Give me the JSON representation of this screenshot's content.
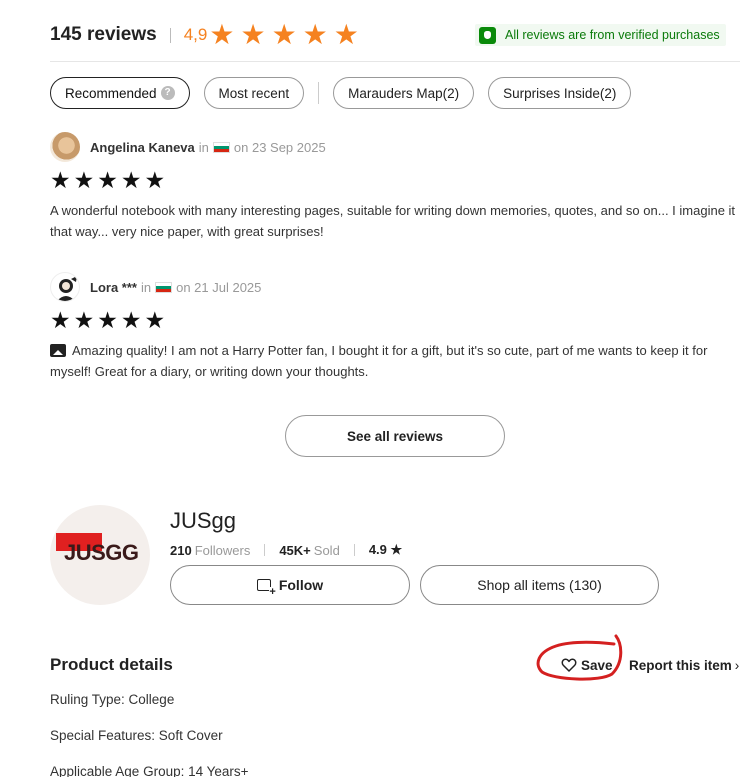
{
  "header": {
    "review_count": "145 reviews",
    "rating": "4,9",
    "rating_stars": 5,
    "verified_text": "All reviews are from verified purchases",
    "accent_color": "#f58220",
    "verified_color": "#0a8a0a"
  },
  "filters": {
    "recommended": "Recommended",
    "help": "?",
    "most_recent": "Most recent",
    "tag1": "Marauders Map(2)",
    "tag2": "Surprises Inside(2)"
  },
  "reviews": [
    {
      "name": "Angelina Kaneva",
      "in_text": "in",
      "date": "on 23 Sep 2025",
      "stars": 5,
      "text": "A wonderful notebook with many interesting pages, suitable for writing down memories, quotes, and so on... I imagine it that way... very nice paper, with great surprises!"
    },
    {
      "name": "Lora ***",
      "in_text": "in",
      "date": "on 21 Jul 2025",
      "stars": 5,
      "text": "Amazing quality! I am not a Harry Potter fan, I bought it for a gift, but it's so cute, part of me wants to keep it for myself! Great for a diary, or writing down your thoughts."
    }
  ],
  "see_all": "See all reviews",
  "shop": {
    "logo_text": "JUSGG",
    "name": "JUSgg",
    "followers_value": "210",
    "followers_label": "Followers",
    "sold_value": "45K+",
    "sold_label": "Sold",
    "rating": "4.9 ★",
    "follow_label": "Follow",
    "shop_all_label": "Shop all items (130)"
  },
  "product": {
    "title": "Product details",
    "save_label": "Save",
    "report_label": "Report this item",
    "details": [
      "Ruling Type: College",
      "Special Features: Soft Cover",
      "Applicable Age Group: 14 Years+"
    ]
  }
}
